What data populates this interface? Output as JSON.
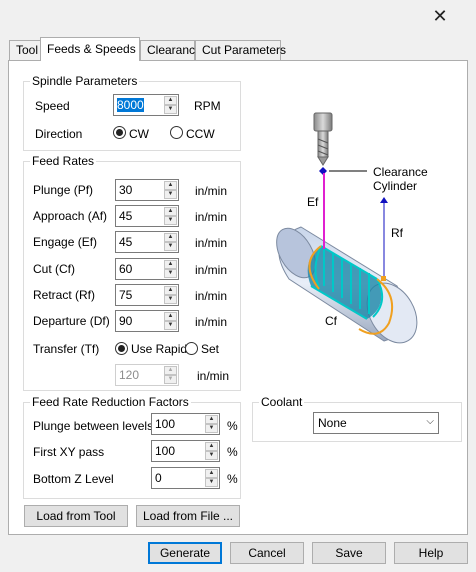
{
  "window": {
    "close_glyph": "✕"
  },
  "tabs": [
    {
      "label": "Tool"
    },
    {
      "label": "Feeds & Speeds",
      "active": true
    },
    {
      "label": "Clearance"
    },
    {
      "label": "Cut Parameters"
    }
  ],
  "spindle": {
    "title": "Spindle Parameters",
    "speed_label": "Speed",
    "speed_value": "8000",
    "speed_unit": "RPM",
    "direction_label": "Direction",
    "cw_label": "CW",
    "ccw_label": "CCW",
    "direction_selected": "CW"
  },
  "feed_rates": {
    "title": "Feed Rates",
    "unit": "in/min",
    "rows": [
      {
        "label": "Plunge (Pf)",
        "value": "30"
      },
      {
        "label": "Approach (Af)",
        "value": "45"
      },
      {
        "label": "Engage (Ef)",
        "value": "45"
      },
      {
        "label": "Cut (Cf)",
        "value": "60"
      },
      {
        "label": "Retract (Rf)",
        "value": "75"
      },
      {
        "label": "Departure  (Df)",
        "value": "90"
      }
    ],
    "transfer_label": "Transfer (Tf)",
    "use_rapid_label": "Use Rapid",
    "set_label": "Set",
    "transfer_selected": "Use Rapid",
    "transfer_value": "120",
    "transfer_unit": "in/min"
  },
  "reduction": {
    "title": "Feed Rate Reduction Factors",
    "unit": "%",
    "rows": [
      {
        "label": "Plunge between levels",
        "value": "100"
      },
      {
        "label": "First XY pass",
        "value": "100"
      },
      {
        "label": "Bottom Z Level",
        "value": "0"
      }
    ]
  },
  "load_buttons": {
    "from_tool": "Load from Tool",
    "from_file": "Load from File ..."
  },
  "coolant": {
    "title": "Coolant",
    "value": "None"
  },
  "diagram": {
    "clearance_label": "Clearance",
    "cylinder_label": "Cylinder",
    "ef_label": "Ef",
    "rf_label": "Rf",
    "cf_label": "Cf",
    "colors": {
      "engage": "#e020d0",
      "retract": "#1010c0",
      "cut": "#00c8c8",
      "arc": "#f0a020"
    }
  },
  "footer": {
    "generate": "Generate",
    "cancel": "Cancel",
    "save": "Save",
    "help": "Help"
  }
}
